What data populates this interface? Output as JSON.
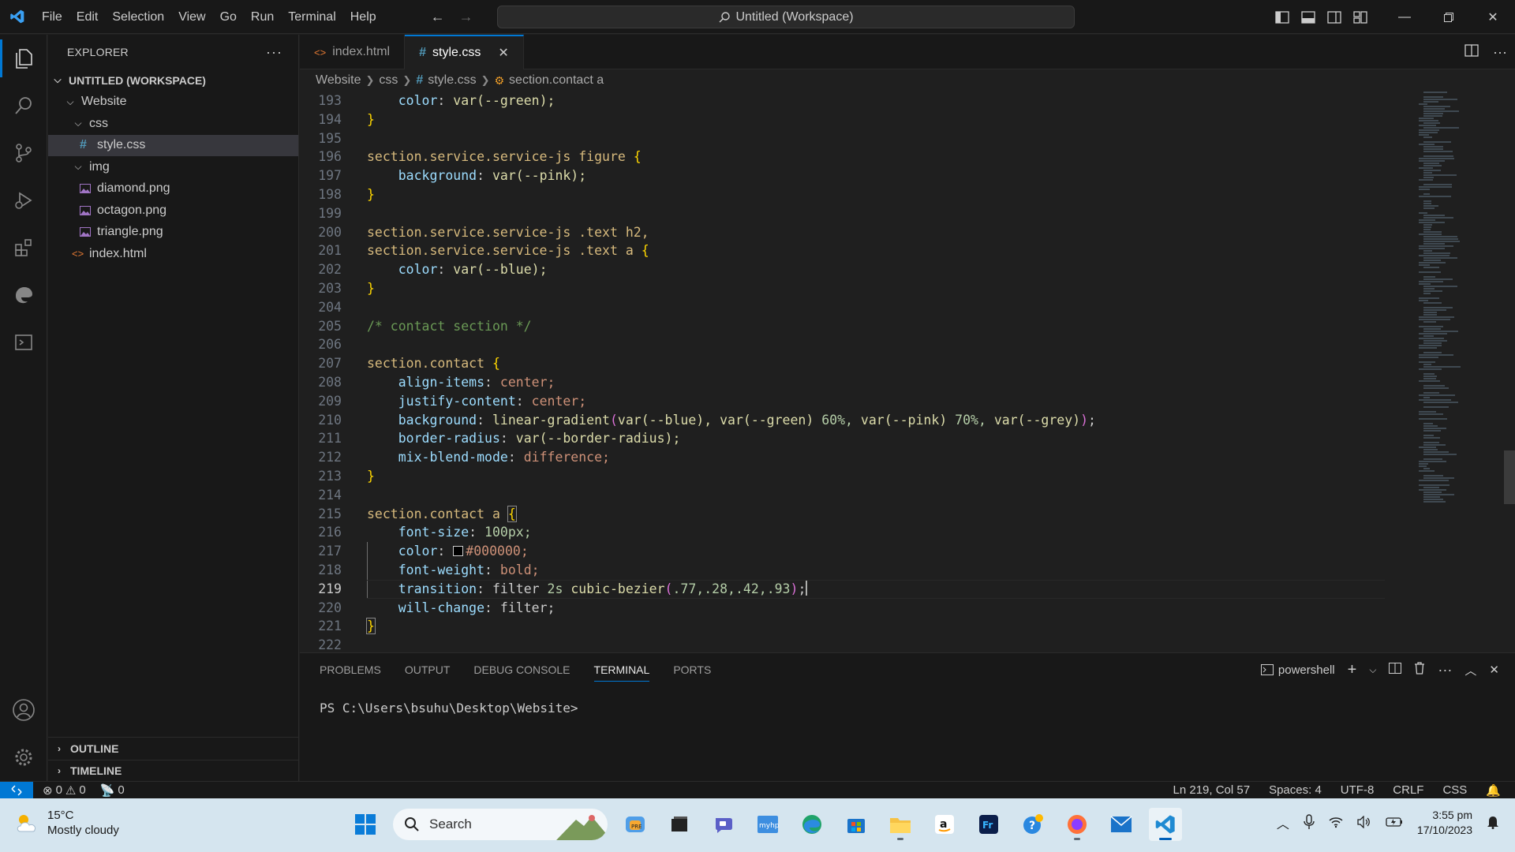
{
  "window": {
    "title": "Untitled (Workspace)",
    "menu": [
      "File",
      "Edit",
      "Selection",
      "View",
      "Go",
      "Run",
      "Terminal",
      "Help"
    ]
  },
  "sidebar": {
    "header": "EXPLORER",
    "workspace": "UNTITLED (WORKSPACE)",
    "tree": {
      "website": "Website",
      "css": "css",
      "style_css": "style.css",
      "img": "img",
      "diamond": "diamond.png",
      "octagon": "octagon.png",
      "triangle": "triangle.png",
      "index": "index.html"
    },
    "outline": "OUTLINE",
    "timeline": "TIMELINE"
  },
  "tabs": [
    {
      "label": "index.html",
      "active": false
    },
    {
      "label": "style.css",
      "active": true
    }
  ],
  "breadcrumb": [
    "Website",
    "css",
    "style.css",
    "section.contact a"
  ],
  "editor": {
    "current_line": 219,
    "lines": [
      193,
      194,
      195,
      196,
      197,
      198,
      199,
      200,
      201,
      202,
      203,
      204,
      205,
      206,
      207,
      208,
      209,
      210,
      211,
      212,
      213,
      214,
      215,
      216,
      217,
      218,
      219,
      220,
      221,
      222
    ],
    "code": {
      "l193_prop": "color",
      "l193_val": "var(--green);",
      "l196": "section.service.service-js figure",
      "l197_prop": "background",
      "l197_val": "var(--pink);",
      "l200": "section.service.service-js .text h2,",
      "l201": "section.service.service-js .text a",
      "l202_prop": "color",
      "l202_val": "var(--blue);",
      "l205": "/* contact section */",
      "l207": "section.contact",
      "l208_prop": "align-items",
      "l208_val": "center;",
      "l209_prop": "justify-content",
      "l209_val": "center;",
      "l210_prop": "background",
      "l210_fn": "linear-gradient",
      "l210_a": "var(--blue),",
      "l210_b": "var(--green)",
      "l210_c": "60%,",
      "l210_d": "var(--pink)",
      "l210_e": "70%,",
      "l210_f": "var(--grey)",
      "l211_prop": "border-radius",
      "l211_val": "var(--border-radius);",
      "l212_prop": "mix-blend-mode",
      "l212_val": "difference;",
      "l215": "section.contact a",
      "l216_prop": "font-size",
      "l216_val": "100px;",
      "l217_prop": "color",
      "l217_val": "#000000;",
      "l218_prop": "font-weight",
      "l218_val": "bold;",
      "l219_prop": "transition",
      "l219_a": "filter",
      "l219_b": "2s",
      "l219_fn": "cubic-bezier",
      "l219_args": ".77,.28,.42,.93",
      "l220_prop": "will-change",
      "l220_val": "filter;"
    }
  },
  "panel": {
    "tabs": [
      "PROBLEMS",
      "OUTPUT",
      "DEBUG CONSOLE",
      "TERMINAL",
      "PORTS"
    ],
    "active_tab": "TERMINAL",
    "shell": "powershell",
    "prompt": "PS C:\\Users\\bsuhu\\Desktop\\Website>"
  },
  "statusbar": {
    "errors": "0",
    "warnings": "0",
    "ports": "0",
    "position": "Ln 219, Col 57",
    "spaces": "Spaces: 4",
    "encoding": "UTF-8",
    "eol": "CRLF",
    "language": "CSS"
  },
  "taskbar": {
    "temperature": "15°C",
    "weather": "Mostly cloudy",
    "search_placeholder": "Search",
    "time": "3:55 pm",
    "date": "17/10/2023"
  },
  "colors": {
    "accent": "#0078d4",
    "editor_bg": "#1f1f1f",
    "sidebar_bg": "#181818"
  }
}
